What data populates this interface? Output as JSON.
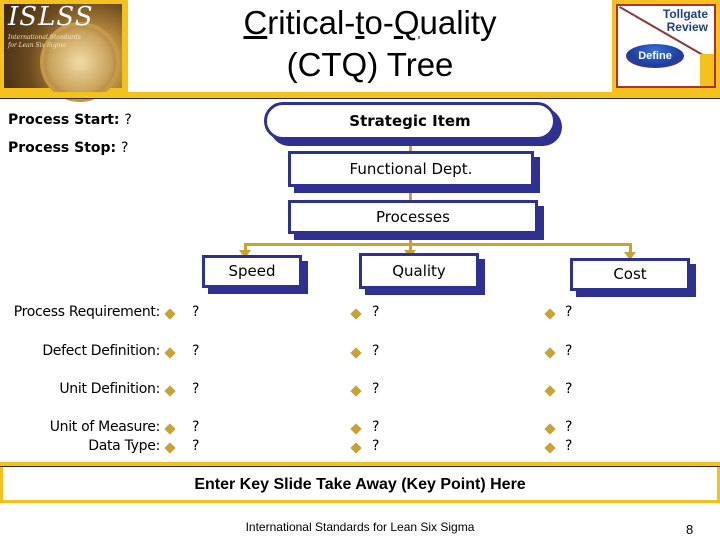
{
  "header": {
    "logo": {
      "title": "ISLSS",
      "subtitle_line1": "International Standards",
      "subtitle_line2": "for Lean Six Sigma"
    },
    "title_line1_parts": [
      "C",
      "ritical-",
      "t",
      "o-",
      "Q",
      "uality"
    ],
    "title_line2": "(CTQ) Tree",
    "tollgate": {
      "title_line1": "Tollgate",
      "title_line2": "Review",
      "phase": "Define"
    }
  },
  "process": {
    "start_label": "Process Start:",
    "start_value": "?",
    "stop_label": "Process Stop:",
    "stop_value": "?"
  },
  "tree": {
    "strategic_item": "Strategic Item",
    "functional_dept": "Functional Dept.",
    "processes": "Processes",
    "branches": [
      "Speed",
      "Quality",
      "Cost"
    ]
  },
  "rows": [
    {
      "label": "Process Requirement:",
      "values": [
        "?",
        "?",
        "?"
      ]
    },
    {
      "label": "Defect Definition:",
      "values": [
        "?",
        "?",
        "?"
      ]
    },
    {
      "label": "Unit Definition:",
      "values": [
        "?",
        "?",
        "?"
      ]
    },
    {
      "label": "Unit of Measure:",
      "values": [
        "?",
        "?",
        "?"
      ]
    },
    {
      "label": "Data Type:",
      "values": [
        "?",
        "?",
        "?"
      ]
    }
  ],
  "footer": {
    "takeaway": "Enter Key Slide Take Away (Key Point) Here",
    "organization": "International Standards for Lean Six Sigma",
    "page_number": "8"
  },
  "colors": {
    "accent_gold": "#f5c11c",
    "box_navy": "#2e3192",
    "connector": "#c9a233"
  }
}
